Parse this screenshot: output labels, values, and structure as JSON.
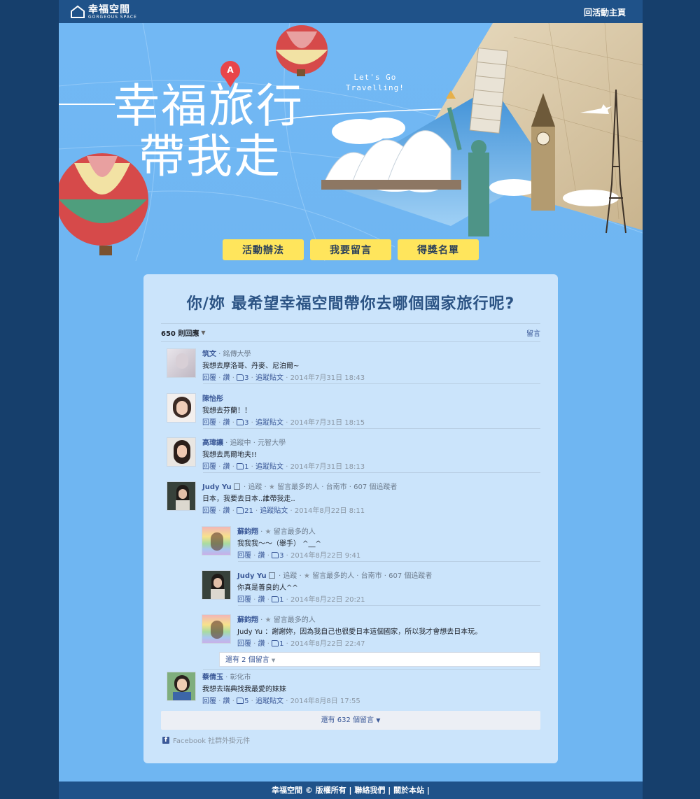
{
  "header": {
    "logo_cn": "幸福空間",
    "logo_en": "GORGEOUS SPACE",
    "back_link": "回活動主頁"
  },
  "hero": {
    "title_line1": "幸福旅行",
    "title_line2": "帶我走",
    "tagline_line1": "Let's Go",
    "tagline_line2": "Travelling!",
    "pin_label": "A"
  },
  "nav": {
    "rules": "活動辦法",
    "comment": "我要留言",
    "winners": "得獎名單"
  },
  "card": {
    "question": "你/妳 最希望幸福空間帶你去哪個國家旅行呢?",
    "comment_count": "650 則回應",
    "post_label": "留言"
  },
  "comments": [
    {
      "name": "筑文",
      "meta": " · 銘傳大學",
      "text": "我想去摩洛哥、丹麥、尼泊爾~",
      "reply": "回覆",
      "like": "讚",
      "likes": "3",
      "follow": "追蹤貼文",
      "time": "2014年7月31日 18:43"
    },
    {
      "name": "陳怡彤",
      "meta": "",
      "text": "我想去芬蘭！！",
      "reply": "回覆",
      "like": "讚",
      "likes": "3",
      "follow": "追蹤貼文",
      "time": "2014年7月31日 18:15"
    },
    {
      "name": "高瑋讓",
      "meta": " ·  追蹤中 · 元智大學",
      "text": "我想去馬爾地夫!!",
      "reply": "回覆",
      "like": "讚",
      "likes": "1",
      "follow": "追蹤貼文",
      "time": "2014年7月31日 18:13"
    },
    {
      "name": "Judy Yu",
      "meta": " · 追蹤 ·",
      "meta2": " 留言最多的人 · 台南市 · 607 個追蹤者",
      "text": "日本，我要去日本..誰帶我走..",
      "reply": "回覆",
      "like": "讚",
      "likes": "21",
      "follow": "追蹤貼文",
      "time": "2014年8月22日 8:11"
    }
  ],
  "replies": [
    {
      "name": "蘇鈞翔",
      "meta": " · ",
      "meta2": " 留言最多的人",
      "text": "我我我～～（舉手） ^__^",
      "reply": "回覆",
      "like": "讚",
      "likes": "3",
      "time": "2014年8月22日 9:41"
    },
    {
      "name": "Judy Yu",
      "meta": " · 追蹤 ·",
      "meta2": " 留言最多的人 · 台南市 · 607 個追蹤者",
      "text": "你真是善良的人^^",
      "reply": "回覆",
      "like": "讚",
      "likes": "1",
      "time": "2014年8月22日 20:21"
    },
    {
      "name": "蘇鈞翔",
      "meta": " · ",
      "meta2": " 留言最多的人",
      "text": "Judy Yu ：謝謝妳，因為我自己也很愛日本這個國家，所以我才會想去日本玩。",
      "reply": "回覆",
      "like": "讚",
      "likes": "1",
      "time": "2014年8月22日 22:47"
    }
  ],
  "more_replies": "還有 2 個留言",
  "last_comment": {
    "name": "蔡倩玉",
    "meta": " · 彰化市",
    "text": "我想去瑞典找我最愛的妹妹",
    "reply": "回覆",
    "like": "讚",
    "likes": "5",
    "follow": "追蹤貼文",
    "time": "2014年8月8日 17:55"
  },
  "more_comments": "還有 632 個留言",
  "fb_plugin": "Facebook 社群外掛元件",
  "footer": {
    "copyright": "幸福空間 © 版權所有 | ",
    "contact": "聯絡我們",
    "sep": " | ",
    "about": "關於本站",
    "end": " |"
  },
  "colors": {
    "page_bg": "#163f6c",
    "header_bg": "#1f5289",
    "hero_bg": "#6fb6f2",
    "card_bg": "#cbe4fb",
    "button_bg": "#ffe55c",
    "title_blue": "#2b5384",
    "fb_link": "#3b5998"
  }
}
